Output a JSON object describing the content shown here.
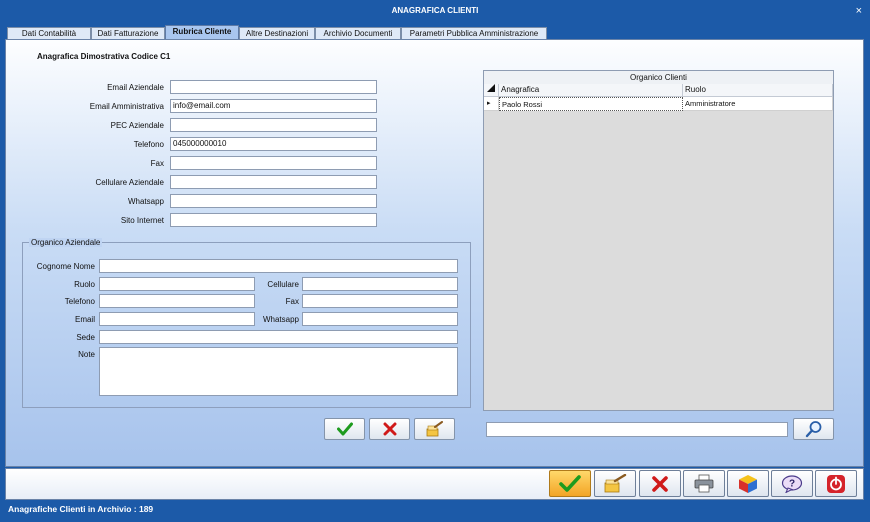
{
  "window": {
    "title": "ANAGRAFICA CLIENTI",
    "close_glyph": "×"
  },
  "tabs": [
    {
      "label": "Dati Contabilità"
    },
    {
      "label": "Dati Fatturazione"
    },
    {
      "label": "Rubrica Cliente"
    },
    {
      "label": "Altre Destinazioni"
    },
    {
      "label": "Archivio Documenti"
    },
    {
      "label": "Parametri Pubblica Amministrazione"
    }
  ],
  "active_tab": "Rubrica Cliente",
  "heading": "Anagrafica Dimostrativa Codice C1",
  "contacts": {
    "email_aziendale": {
      "label": "Email Aziendale",
      "value": ""
    },
    "email_amministrativa": {
      "label": "Email Amministrativa",
      "value": "info@email.com"
    },
    "pec_aziendale": {
      "label": "PEC Aziendale",
      "value": ""
    },
    "telefono": {
      "label": "Telefono",
      "value": "045000000010"
    },
    "fax": {
      "label": "Fax",
      "value": ""
    },
    "cellulare_aziendale": {
      "label": "Cellulare Aziendale",
      "value": ""
    },
    "whatsapp": {
      "label": "Whatsapp",
      "value": ""
    },
    "sito_internet": {
      "label": "Sito Internet",
      "value": ""
    }
  },
  "organico": {
    "title": "Organico Aziendale",
    "cognome_nome": {
      "label": "Cognome Nome",
      "value": ""
    },
    "ruolo": {
      "label": "Ruolo",
      "value": ""
    },
    "cellulare": {
      "label": "Cellulare",
      "value": ""
    },
    "telefono": {
      "label": "Telefono",
      "value": ""
    },
    "fax": {
      "label": "Fax",
      "value": ""
    },
    "email": {
      "label": "Email",
      "value": ""
    },
    "whatsapp": {
      "label": "Whatsapp",
      "value": ""
    },
    "sede": {
      "label": "Sede",
      "value": ""
    },
    "note": {
      "label": "Note",
      "value": ""
    }
  },
  "grid": {
    "title": "Organico Clienti",
    "columns": [
      "Anagrafica",
      "Ruolo"
    ],
    "rows": [
      {
        "anagrafica": "Paolo Rossi",
        "ruolo": "Amministratore"
      }
    ]
  },
  "search": {
    "value": ""
  },
  "status": {
    "text": "Anagrafiche Clienti in Archivio :  189"
  },
  "icons": {
    "confirm": "check-icon",
    "cancel": "x-icon",
    "clear": "broom-icon",
    "search": "magnifier-icon",
    "print": "printer-icon",
    "palette": "cube-icon",
    "help": "help-icon",
    "exit": "power-icon"
  },
  "colors": {
    "accent": "#1c5aa8",
    "check": "#1e9b1e",
    "cross": "#d01a1a",
    "tab_active": "#a9c6ef"
  }
}
